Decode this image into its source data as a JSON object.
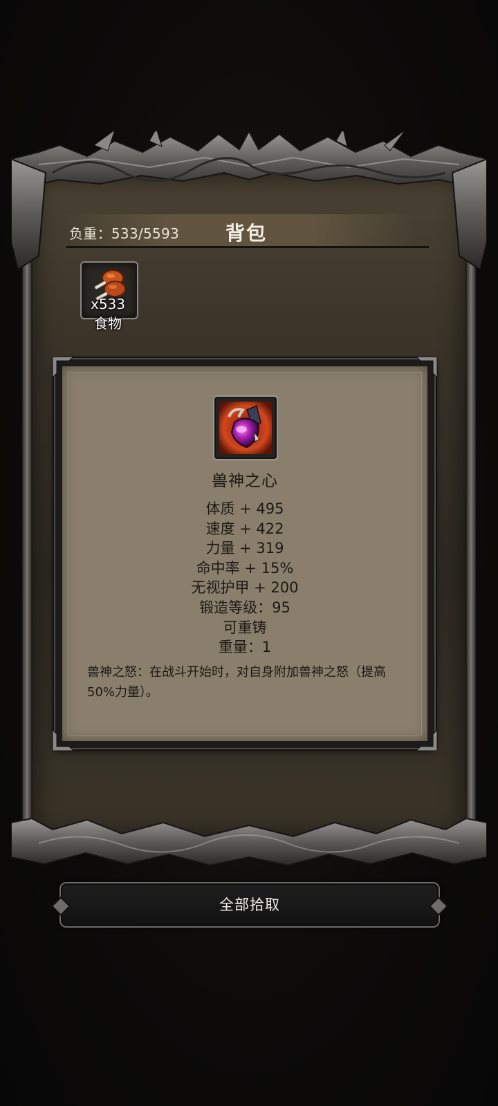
{
  "backpack": {
    "title": "背包",
    "weight_label": "负重：533/5593"
  },
  "inventory": {
    "items": [
      {
        "icon": "meat-drumstick-icon",
        "count": "x533",
        "name": "食物"
      }
    ]
  },
  "item_detail": {
    "icon": "beast-god-heart-icon",
    "name": "兽神之心",
    "stats": [
      "体质 + 495",
      "速度 + 422",
      "力量 + 319",
      "命中率 + 15%",
      "无视护甲 + 200",
      "锻造等级：95",
      "可重铸",
      "重量：1"
    ],
    "description": "兽神之怒：在战斗开始时，对自身附加兽神之怒（提高50%力量）。"
  },
  "actions": {
    "pickup_all_label": "全部拾取"
  },
  "colors": {
    "panel_brown": "#3a3429",
    "detail_parchment": "#8a7f6d",
    "frame_silver": "#8a8680"
  }
}
